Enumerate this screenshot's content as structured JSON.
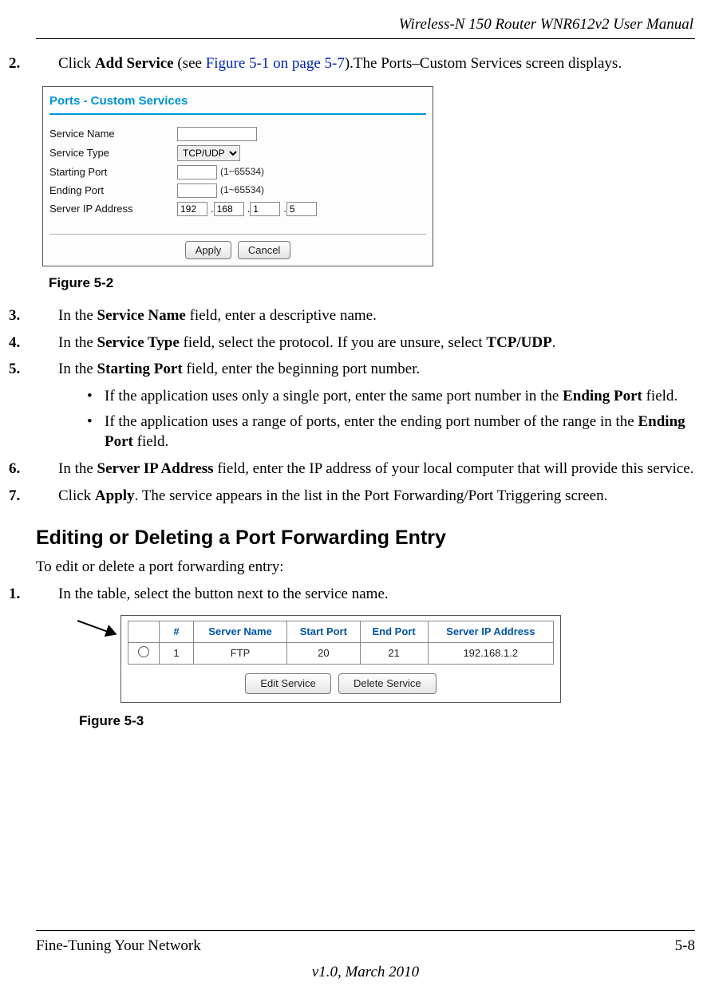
{
  "header": {
    "title": "Wireless-N 150 Router WNR612v2 User Manual"
  },
  "step2": {
    "num": "2.",
    "pre": "Click ",
    "bold": "Add Service",
    "mid": " (see ",
    "link": "Figure 5-1 on page 5-7",
    "post": ").The Ports–Custom Services screen displays."
  },
  "figure1": {
    "title": "Ports - Custom Services",
    "rows": {
      "serviceName": {
        "label": "Service Name",
        "value": ""
      },
      "serviceType": {
        "label": "Service Type",
        "value": "TCP/UDP"
      },
      "startingPort": {
        "label": "Starting Port",
        "value": "",
        "suffix": "(1~65534)"
      },
      "endingPort": {
        "label": "Ending Port",
        "value": "",
        "suffix": "(1~65534)"
      },
      "serverIp": {
        "label": "Server IP Address",
        "oct1": "192",
        "oct2": "168",
        "oct3": "1",
        "oct4": "5"
      }
    },
    "buttons": {
      "apply": "Apply",
      "cancel": "Cancel"
    },
    "caption": "Figure 5-2"
  },
  "step3": {
    "num": "3.",
    "pre": "In the ",
    "bold": "Service Name",
    "post": " field, enter a descriptive name."
  },
  "step4": {
    "num": "4.",
    "pre": "In the ",
    "bold": "Service Type",
    "mid": " field, select the protocol. If you are unsure, select ",
    "bold2": "TCP/UDP",
    "post": "."
  },
  "step5": {
    "num": "5.",
    "pre": "In the ",
    "bold": "Starting Port",
    "post": " field, enter the beginning port number."
  },
  "bullets": {
    "b1": {
      "pre": "If the application uses only a single port, enter the same port number in the ",
      "bold": "Ending Port",
      "post": " field."
    },
    "b2": {
      "pre": "If the application uses a range of ports, enter the ending port number of the range in the ",
      "bold": "Ending Port",
      "post": " field."
    }
  },
  "step6": {
    "num": "6.",
    "pre": "In the ",
    "bold": "Server IP Address",
    "post": " field, enter the IP address of your local computer that will provide this service."
  },
  "step7": {
    "num": "7.",
    "pre": "Click ",
    "bold": "Apply",
    "post": ". The service appears in the list in the Port Forwarding/Port Triggering screen."
  },
  "section2": {
    "heading": "Editing or Deleting a Port Forwarding Entry",
    "intro": "To edit or delete a port forwarding entry:"
  },
  "step_s2_1": {
    "num": "1.",
    "text": "In the table, select the button next to the service name."
  },
  "figure2": {
    "headers": {
      "radio": "",
      "num": "#",
      "name": "Server Name",
      "start": "Start Port",
      "end": "End Port",
      "ip": "Server IP Address"
    },
    "row": {
      "num": "1",
      "name": "FTP",
      "start": "20",
      "end": "21",
      "ip": "192.168.1.2"
    },
    "buttons": {
      "edit": "Edit Service",
      "delete": "Delete Service"
    },
    "caption": "Figure 5-3"
  },
  "footer": {
    "left": "Fine-Tuning Your Network",
    "right": "5-8",
    "center": "v1.0, March 2010"
  }
}
